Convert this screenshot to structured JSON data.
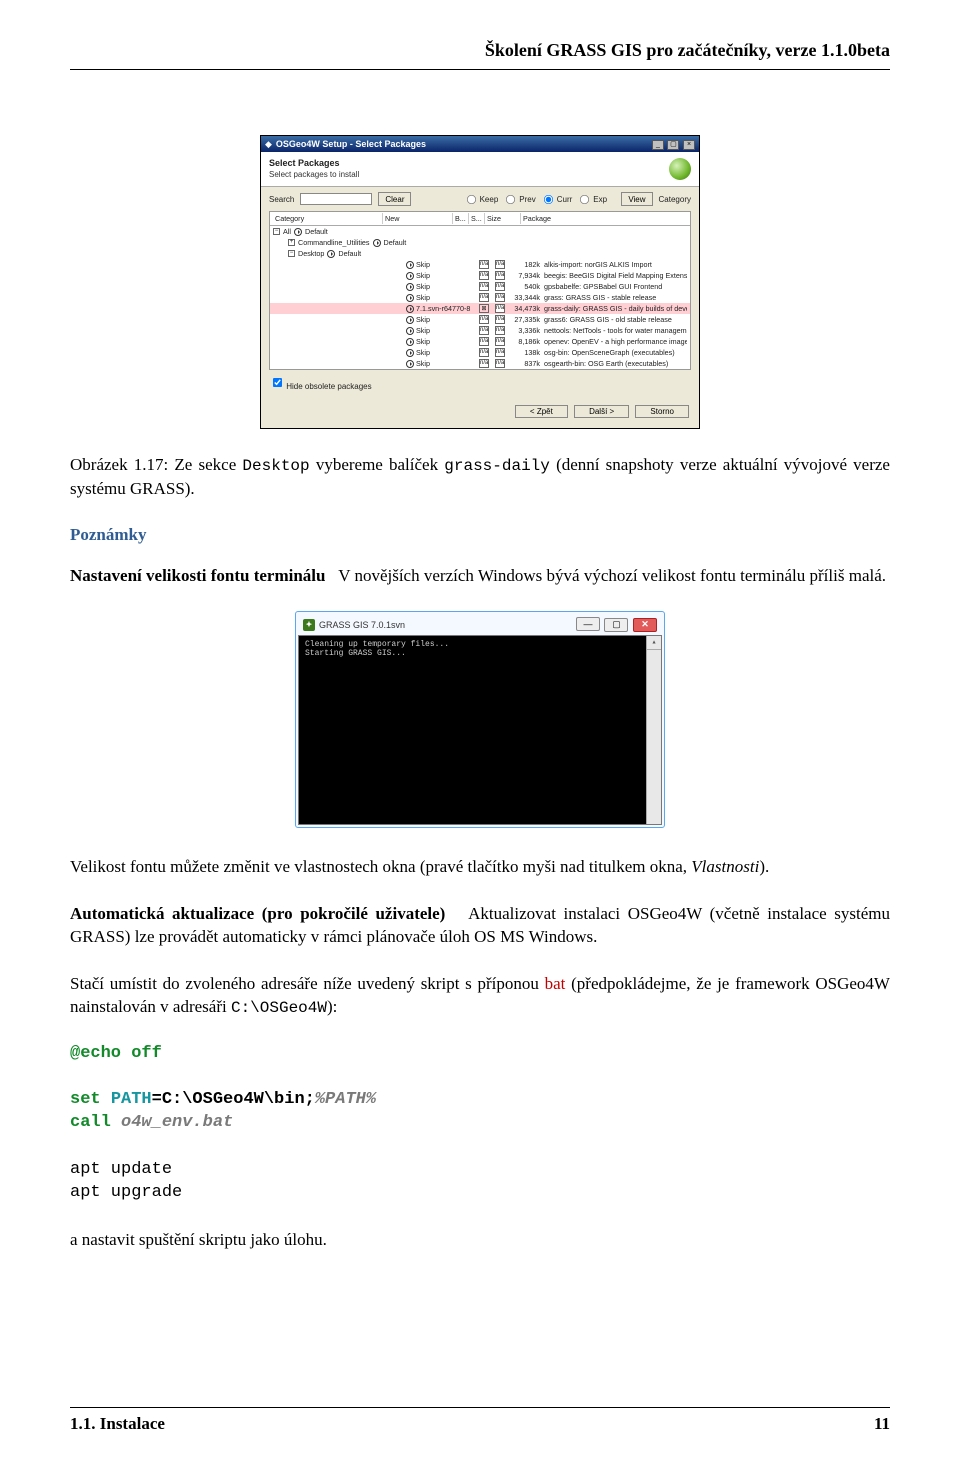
{
  "header": {
    "title": "Školení GRASS GIS pro začátečníky, verze 1.1.0beta"
  },
  "installer": {
    "window_title": "OSGeo4W Setup - Select Packages",
    "head_title": "Select Packages",
    "head_sub": "Select packages to install",
    "search_label": "Search",
    "search_value": "",
    "clear_label": "Clear",
    "radios": {
      "keep": "Keep",
      "prev": "Prev",
      "curr": "Curr",
      "exp": "Exp"
    },
    "view_label": "View",
    "view_value": "Category",
    "columns": {
      "category": "Category",
      "new": "New",
      "b": "B...",
      "s": "S...",
      "size": "Size",
      "package": "Package"
    },
    "root": {
      "label": "All",
      "action": "Default"
    },
    "cat_cmdline": {
      "label": "Commandline_Utilities",
      "action": "Default"
    },
    "cat_desktop": {
      "label": "Desktop",
      "action": "Default"
    },
    "rows": [
      {
        "new": "Skip",
        "b": "n/a",
        "s": "n/a",
        "size": "182k",
        "pkg": "alkis-import: norGIS ALKIS Import",
        "sel": false
      },
      {
        "new": "Skip",
        "b": "n/a",
        "s": "n/a",
        "size": "7,934k",
        "pkg": "beegis: BeeGIS Digital Field Mapping Extensions",
        "sel": false
      },
      {
        "new": "Skip",
        "b": "n/a",
        "s": "n/a",
        "size": "540k",
        "pkg": "gpsbabelfe: GPSBabel GUI Frontend",
        "sel": false
      },
      {
        "new": "Skip",
        "b": "n/a",
        "s": "n/a",
        "size": "33,344k",
        "pkg": "grass: GRASS GIS - stable release",
        "sel": false
      },
      {
        "new": "7.1.svn-r64770-8",
        "b": "⊠",
        "s": "n/a",
        "size": "34,473k",
        "pkg": "grass-daily: GRASS GIS - daily builds of development version",
        "sel": true
      },
      {
        "new": "Skip",
        "b": "n/a",
        "s": "n/a",
        "size": "27,335k",
        "pkg": "grass6: GRASS GIS - old stable release",
        "sel": false
      },
      {
        "new": "Skip",
        "b": "n/a",
        "s": "n/a",
        "size": "3,336k",
        "pkg": "nettools: NetTools - tools for water management",
        "sel": false
      },
      {
        "new": "Skip",
        "b": "n/a",
        "s": "n/a",
        "size": "8,186k",
        "pkg": "openev: OpenEV - a high performance image viewer",
        "sel": false
      },
      {
        "new": "Skip",
        "b": "n/a",
        "s": "n/a",
        "size": "138k",
        "pkg": "osg-bin: OpenSceneGraph (executables)",
        "sel": false
      },
      {
        "new": "Skip",
        "b": "n/a",
        "s": "n/a",
        "size": "837k",
        "pkg": "osgearth-bin: OSG Earth (executables)",
        "sel": false
      }
    ],
    "hide_label": "Hide obsolete packages",
    "btn_back": "< Zpět",
    "btn_next": "Další >",
    "btn_cancel": "Storno"
  },
  "caption1": {
    "prefix": "Obrázek 1.17: Ze sekce ",
    "code1": "Desktop",
    "mid": " vybereme balíček ",
    "code2": "grass-daily",
    "suffix": " (denní snapshoty verze aktuální vývojové verze systému GRASS)."
  },
  "notes": {
    "title": "Poznámky",
    "p1_runin": "Nastavení velikosti fontu terminálu",
    "p1_rest": "V novějších verzích Windows bývá výchozí velikost fontu terminálu příliš malá."
  },
  "terminal": {
    "title": "GRASS GIS 7.0.1svn",
    "line1": "Cleaning up temporary files...",
    "line2": "Starting GRASS GIS..."
  },
  "p2": {
    "a": "Velikost fontu můžete změnit ve vlastnostech okna (pravé tlačítko myši nad titulkem okna, ",
    "b": "Vlastnosti",
    "c": ")."
  },
  "p3": {
    "runin": "Automatická aktualizace (pro pokročilé uživatele)",
    "rest": "Aktualizovat instalaci OSGeo4W (včetně instalace systému GRASS) lze provádět automaticky v rámci plánovače úloh OS MS Windows."
  },
  "p4": {
    "a": "Stačí umístit do zvoleného adresáře níže uvedený skript s příponou ",
    "bat": "bat",
    "b": " (předpokládejme, že je framework OSGeo4W nainstalován v adresáři ",
    "path": "C:\\OSGeo4W",
    "c": "):"
  },
  "code": {
    "l1a": "@echo off",
    "l2a": "set ",
    "l2b": "PATH",
    "l2c": "=C:\\OSGeo4W\\bin;",
    "l2d": "%PATH%",
    "l3a": "call ",
    "l3b": "o4w_env.bat",
    "l4": "apt update",
    "l5": "apt upgrade"
  },
  "p5": "a nastavit spuštění skriptu jako úlohu.",
  "footer": {
    "left": "1.1. Instalace",
    "right": "11"
  }
}
